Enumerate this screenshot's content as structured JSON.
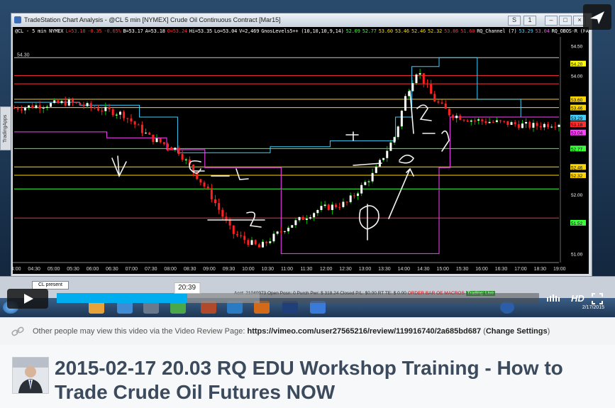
{
  "window": {
    "title": "TradeStation Chart Analysis - @CL 5 min [NYMEX] Crude Oil Continuous Contract [Mar15]",
    "left_tab_label": "TradingApps",
    "tab_label": "CL present"
  },
  "chart": {
    "status_items": [
      {
        "text": "@CL - 5 min  NYMEX",
        "color": "#ffffff"
      },
      {
        "text": "L=53.18",
        "color": "#ff3030"
      },
      {
        "text": "-0.35",
        "color": "#ff3030"
      },
      {
        "text": "-0.65%",
        "color": "#ff3030"
      },
      {
        "text": "B=53.17",
        "color": "#ffffff"
      },
      {
        "text": "A=53.18",
        "color": "#ffffff"
      },
      {
        "text": "O=53.24",
        "color": "#ff3030"
      },
      {
        "text": "Hi=53.35",
        "color": "#ffffff"
      },
      {
        "text": "Lo=53.04",
        "color": "#ffffff"
      },
      {
        "text": "V=2,469",
        "color": "#ffffff"
      },
      {
        "text": "GnosLevels5++ (10,10,10,9,14)",
        "color": "#ffffff"
      },
      {
        "text": "52.09",
        "color": "#3cff3c"
      },
      {
        "text": "52.77",
        "color": "#3cff3c"
      },
      {
        "text": "53.60",
        "color": "#ffd700"
      },
      {
        "text": "53.46",
        "color": "#ffd700"
      },
      {
        "text": "52.46",
        "color": "#ffd700"
      },
      {
        "text": "52.32",
        "color": "#ffd700"
      },
      {
        "text": "53.86",
        "color": "#ff3030"
      },
      {
        "text": "51.60",
        "color": "#ff3030"
      },
      {
        "text": "RQ_Channel (7)",
        "color": "#ffffff"
      },
      {
        "text": "53.29",
        "color": "#40d0ff"
      },
      {
        "text": "53.04",
        "color": "#ff40ff"
      },
      {
        "text": "RQ_OBOS-R (FALSE,TRUE,",
        "color": "#ffffff"
      }
    ],
    "ref_label": "54.30",
    "x_ticks": [
      "04:00",
      "04:30",
      "05:00",
      "05:30",
      "06:00",
      "06:30",
      "07:00",
      "07:30",
      "08:00",
      "08:30",
      "09:00",
      "09:30",
      "10:00",
      "10:30",
      "11:00",
      "11:30",
      "12:00",
      "12:30",
      "13:00",
      "13:30",
      "14:00",
      "14:30",
      "15:00",
      "15:30",
      "16:00",
      "16:30",
      "17:00",
      "18:30",
      "19:00"
    ],
    "y_labels": [
      {
        "text": "54.50",
        "bg": "#000000",
        "fg": "#ffffff",
        "price": 54.5
      },
      {
        "text": "54.20",
        "bg": "#ffff00",
        "fg": "#000000",
        "price": 54.2
      },
      {
        "text": "54.00",
        "bg": "#000000",
        "fg": "#ffffff",
        "price": 54.0
      },
      {
        "text": "53.60",
        "bg": "#ffd700",
        "fg": "#000000",
        "price": 53.6
      },
      {
        "text": "53.46",
        "bg": "#ffd700",
        "fg": "#000000",
        "price": 53.46
      },
      {
        "text": "53.29",
        "bg": "#40d0ff",
        "fg": "#000000",
        "price": 53.29
      },
      {
        "text": "53.18",
        "bg": "#ff3030",
        "fg": "#000000",
        "price": 53.18
      },
      {
        "text": "53.04",
        "bg": "#ff40ff",
        "fg": "#000000",
        "price": 53.04
      },
      {
        "text": "52.77",
        "bg": "#3cff3c",
        "fg": "#000000",
        "price": 52.77
      },
      {
        "text": "52.46",
        "bg": "#ffd700",
        "fg": "#000000",
        "price": 52.46
      },
      {
        "text": "52.32",
        "bg": "#ffd700",
        "fg": "#000000",
        "price": 52.32
      },
      {
        "text": "52.00",
        "bg": "#000000",
        "fg": "#ffffff",
        "price": 52.0
      },
      {
        "text": "51.52",
        "bg": "#3cff3c",
        "fg": "#000000",
        "price": 51.52
      },
      {
        "text": "51.00",
        "bg": "#000000",
        "fg": "#ffffff",
        "price": 51.0
      }
    ],
    "ylim": [
      50.85,
      54.65
    ],
    "levels": [
      {
        "price": 54.3,
        "color": "#c8c8c8"
      },
      {
        "price": 54.0,
        "color": "#ff3030"
      },
      {
        "price": 53.86,
        "color": "#ff3030"
      },
      {
        "price": 53.6,
        "color": "#ffd700"
      },
      {
        "price": 53.46,
        "color": "#ffd700"
      },
      {
        "price": 52.77,
        "color": "#3cff3c"
      },
      {
        "price": 52.09,
        "color": "#3cff3c"
      },
      {
        "price": 52.46,
        "color": "#ffd700"
      },
      {
        "price": 52.32,
        "color": "#ffd700"
      },
      {
        "price": 51.6,
        "color": "#ff3030"
      }
    ],
    "channel_upper": [
      [
        0,
        53.55
      ],
      [
        0.12,
        53.55
      ],
      [
        0.12,
        53.5
      ],
      [
        0.23,
        53.5
      ],
      [
        0.23,
        53.3
      ],
      [
        0.3,
        53.3
      ],
      [
        0.3,
        52.7
      ],
      [
        0.47,
        52.7
      ],
      [
        0.47,
        52.8
      ],
      [
        0.58,
        52.8
      ],
      [
        0.58,
        52.9
      ],
      [
        0.7,
        52.9
      ],
      [
        0.7,
        53.3
      ],
      [
        0.73,
        53.3
      ],
      [
        0.73,
        54.15
      ],
      [
        0.78,
        54.15
      ],
      [
        0.78,
        54.3
      ],
      [
        0.85,
        54.3
      ],
      [
        0.85,
        53.6
      ],
      [
        0.93,
        53.6
      ],
      [
        0.93,
        53.3
      ],
      [
        1,
        53.3
      ]
    ],
    "channel_lower": [
      [
        0,
        53.05
      ],
      [
        0.17,
        53.05
      ],
      [
        0.17,
        52.95
      ],
      [
        0.28,
        52.95
      ],
      [
        0.28,
        52.75
      ],
      [
        0.35,
        52.75
      ],
      [
        0.35,
        52.45
      ],
      [
        0.49,
        52.45
      ],
      [
        0.49,
        51.0
      ],
      [
        0.78,
        51.0
      ],
      [
        0.78,
        52.45
      ],
      [
        0.8,
        52.45
      ],
      [
        0.8,
        53.3
      ],
      [
        1,
        53.3
      ]
    ]
  },
  "status_bar": {
    "account_text": "Acct: 21040973  Open Posn: 0  Purch Pwr: $ 318.24  Closed P/L: $0.00  RT TE: $ 0.00",
    "order_bar": "ORDER BAR   OE MACROS",
    "trading_live": "Trading: Live",
    "clock": "2/17/2015"
  },
  "player": {
    "time_tooltip": "20:39",
    "progress_fraction": 0.27,
    "buffered_fraction": 0.42,
    "hd_label": "HD"
  },
  "review_note": {
    "prefix": "Other people may view this video via the Video Review Page: ",
    "url": "https://vimeo.com/user27565216/review/119916740/2a685bd687",
    "paren_open": " (",
    "settings_label": "Change Settings",
    "paren_close": ")"
  },
  "video_title": "2015-02-17 20.03 RQ EDU Workshop Training - How to Trade Crude Oil Futures NOW"
}
